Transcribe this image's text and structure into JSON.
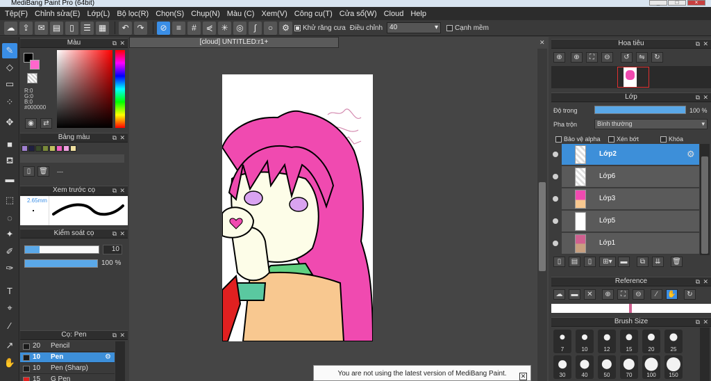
{
  "window": {
    "title": "MediBang Paint Pro (64bit)"
  },
  "menu": [
    "Tệp(F)",
    "Chỉnh sửa(E)",
    "Lớp(L)",
    "Bộ lọc(R)",
    "Chọn(S)",
    "Chụp(N)",
    "Màu (C)",
    "Xem(V)",
    "Công cụ(T)",
    "Cửa sổ(W)",
    "Cloud",
    "Help"
  ],
  "toolbar": {
    "antialias_label": "Khử răng cưa",
    "adjust_label": "Điều chỉnh",
    "adjust_value": "40",
    "soft_edge_label": "Cạnh mềm"
  },
  "color_panel": {
    "title": "Màu",
    "rgb": {
      "r": "R:0",
      "g": "G:0",
      "b": "B:0",
      "hex": "#000000"
    },
    "primary_color": "#000000",
    "secondary_color": "#ff66cc"
  },
  "palette_panel": {
    "title": "Bảng màu",
    "dash_label": "---",
    "swatches": [
      "#a080d0",
      "#202040",
      "#3a4a2a",
      "#7a8a3a",
      "#c0c060",
      "#f060c0",
      "#f0a0e0",
      "#f0e0a0"
    ]
  },
  "brush_preview": {
    "title": "Xem trước cọ",
    "size_label": "2.65mm"
  },
  "brush_control": {
    "title": "Kiểm soát cọ",
    "size_value": "10",
    "opacity_value": "100 %"
  },
  "brush_list": {
    "title": "Cọ: Pen",
    "items": [
      {
        "size": "20",
        "name": "Pencil",
        "color": "#1a1a1a"
      },
      {
        "size": "10",
        "name": "Pen",
        "color": "#1a1a1a",
        "selected": true
      },
      {
        "size": "10",
        "name": "Pen (Sharp)",
        "color": "#1a1a1a"
      },
      {
        "size": "15",
        "name": "G Pen",
        "color": "#e02020"
      }
    ]
  },
  "document": {
    "tab_title": "[cloud] UNTITLED:r1+"
  },
  "navigator": {
    "title": "Hoa tiêu"
  },
  "layers_panel": {
    "title": "Lớp",
    "opacity_label": "Độ trong",
    "opacity_value": "100 %",
    "blend_label": "Pha trộn",
    "blend_value": "Bình thường",
    "protect_alpha": "Bảo vệ alpha",
    "clipping": "Xén bớt",
    "lock": "Khóa",
    "layers": [
      {
        "name": "Lớp2",
        "selected": true
      },
      {
        "name": "Lớp6"
      },
      {
        "name": "Lớp3"
      },
      {
        "name": "Lớp5"
      },
      {
        "name": "Lớp1"
      }
    ]
  },
  "reference": {
    "title": "Reference"
  },
  "brush_size": {
    "title": "Brush Size",
    "sizes": [
      "7",
      "10",
      "12",
      "15",
      "20",
      "25",
      "30",
      "40",
      "50",
      "70",
      "100",
      "150"
    ]
  },
  "notice": {
    "text": "You are not using the latest version of MediBang Paint."
  }
}
